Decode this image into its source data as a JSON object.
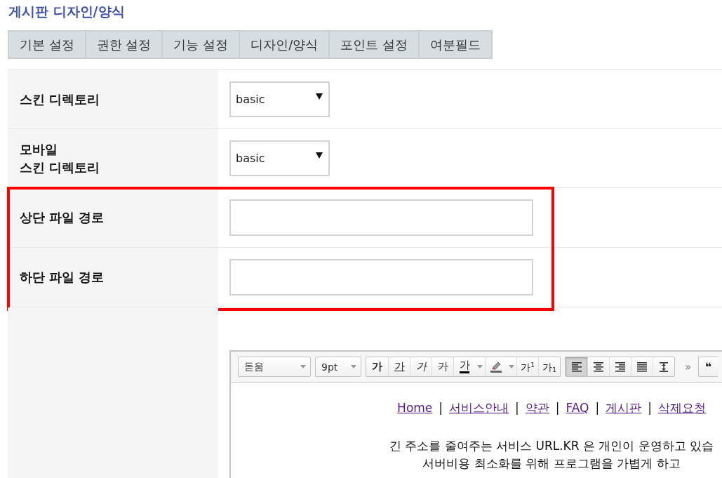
{
  "page_title": "게시판 디자인/양식",
  "tabs": [
    {
      "label": "기본 설정",
      "selected": false
    },
    {
      "label": "권한 설정",
      "selected": false
    },
    {
      "label": "기능 설정",
      "selected": false
    },
    {
      "label": "디자인/양식",
      "selected": false
    },
    {
      "label": "포인트 설정",
      "selected": false
    },
    {
      "label": "여분필드",
      "selected": false
    }
  ],
  "form_rows": [
    {
      "kind": "select",
      "label": "스킨 디렉토리",
      "value": "basic",
      "highlighted": false
    },
    {
      "kind": "select",
      "label": "모바일\n스킨 디렉토리",
      "value": "basic",
      "highlighted": false
    },
    {
      "kind": "text",
      "label": "상단 파일 경로",
      "highlighted": true
    },
    {
      "kind": "text",
      "label": "하단 파일 경로",
      "highlighted": true
    },
    {
      "kind": "editor",
      "highlighted": false,
      "editor": {
        "toolbar": {
          "font": "돋움",
          "size": "9pt",
          "format_buttons": [
            {
              "kind": "bold",
              "label": "가"
            },
            {
              "kind": "underline",
              "label": "가"
            },
            {
              "kind": "italic",
              "label": "가"
            },
            {
              "kind": "strike",
              "label": "가"
            },
            {
              "kind": "color",
              "label": "가",
              "menu": true
            },
            {
              "kind": "highlight",
              "menu": true
            },
            {
              "kind": "superscript",
              "label": "가$^{1}$"
            },
            {
              "kind": "subscript",
              "label": "가$_{1}$"
            }
          ],
          "align_buttons": [
            {
              "kind": "left",
              "selected": true
            },
            {
              "kind": "center",
              "selected": false
            },
            {
              "kind": "right",
              "selected": false
            },
            {
              "kind": "justify",
              "selected": false
            },
            {
              "kind": "line-height",
              "selected": false
            }
          ],
          "more": "»",
          "quote": "❝"
        },
        "links": [
          {
            "text": "Home",
            "separator": "|"
          },
          {
            "text": "서비스안내",
            "separator": "|"
          },
          {
            "text": "약관",
            "separator": "|"
          },
          {
            "text": "FAQ",
            "separator": "|"
          },
          {
            "text": "게시판",
            "separator": "|"
          },
          {
            "text": "삭제요청"
          }
        ],
        "lines": [
          "긴 주소를 줄여주는 서비스 URL.KR 은 개인이 운영하고 있습",
          "서버비용 최소화를 위해 프로그램을 가볍게 하고"
        ]
      }
    }
  ]
}
